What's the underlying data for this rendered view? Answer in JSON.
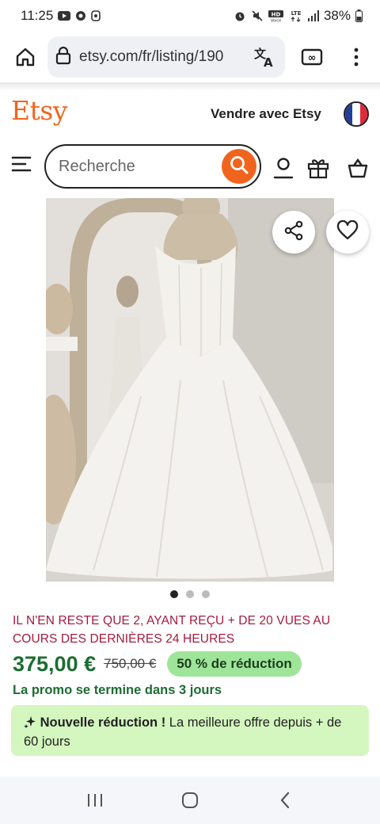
{
  "status_bar": {
    "time": "11:25",
    "battery": "38%"
  },
  "browser": {
    "url": "etsy.com/fr/listing/190"
  },
  "header": {
    "logo": "Etsy",
    "sell_link": "Vendre avec Etsy",
    "search_placeholder": "Recherche"
  },
  "product": {
    "stock_notice": "IL N'EN RESTE QUE 2, AYANT REÇU + DE 20 VUES AU COURS DES DERNIÈRES 24 HEURES",
    "price": "375,00 €",
    "old_price": "750,00 €",
    "discount": "50 % de réduction",
    "promo_end": "La promo se termine dans 3 jours",
    "new_discount_title": "Nouvelle réduction !",
    "new_discount_text": " La meilleure offre depuis + de 60 jours",
    "carousel_active": 1,
    "carousel_count": 3
  },
  "colors": {
    "brand": "#f1641e",
    "price_green": "#1c6d32",
    "notice_red": "#a61a3e",
    "badge_green": "#9ee59a",
    "banner_green": "#d4f6bf"
  },
  "icons": [
    "home-icon",
    "lock-icon",
    "translate-icon",
    "tabs-icon",
    "more-vert-icon",
    "menu-icon",
    "search-icon",
    "account-icon",
    "gift-icon",
    "cart-icon",
    "share-icon",
    "heart-icon",
    "sparkle-icon",
    "recents-icon",
    "home-nav-icon",
    "back-icon"
  ]
}
